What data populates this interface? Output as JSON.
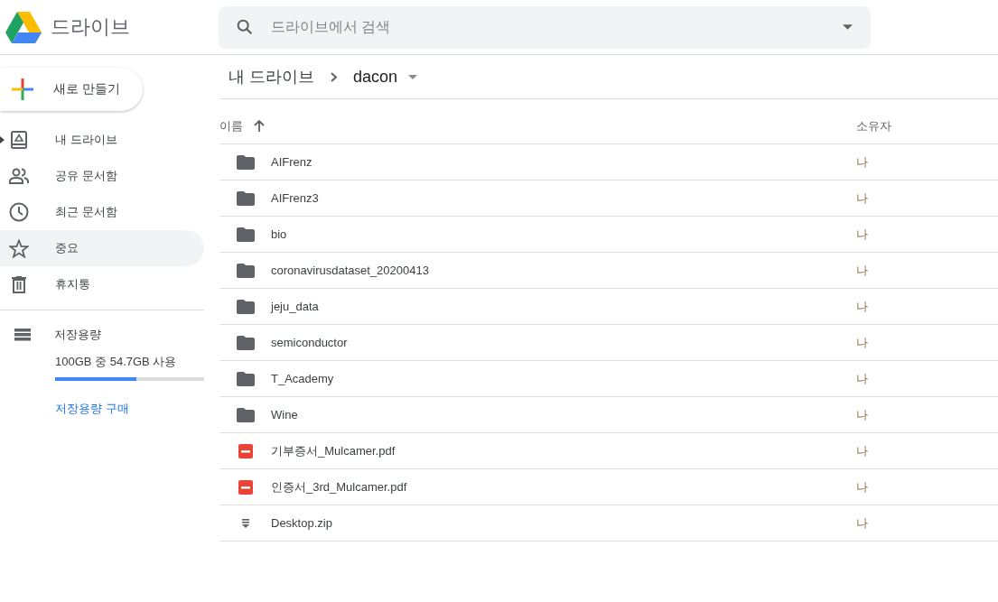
{
  "app": {
    "title": "드라이브"
  },
  "search": {
    "placeholder": "드라이브에서 검색"
  },
  "new_button": {
    "label": "새로 만들기"
  },
  "sidebar": {
    "items": [
      {
        "label": "내 드라이브",
        "kind": "drive",
        "selected": false,
        "expandable": true
      },
      {
        "label": "공유 문서함",
        "kind": "people",
        "selected": false,
        "expandable": false
      },
      {
        "label": "최근 문서함",
        "kind": "clock",
        "selected": false,
        "expandable": false
      },
      {
        "label": "중요",
        "kind": "star",
        "selected": true,
        "expandable": false
      },
      {
        "label": "휴지통",
        "kind": "trash",
        "selected": false,
        "expandable": false
      }
    ]
  },
  "storage": {
    "label": "저장용량",
    "usage": "100GB 중 54.7GB 사용",
    "level": 0.547,
    "buy_link": "저장용량 구매"
  },
  "breadcrumb": {
    "parent": "내 드라이브",
    "current": "dacon"
  },
  "table": {
    "columns": [
      "이름",
      "소유자"
    ],
    "rows": [
      {
        "name": "AIFrenz",
        "kind": "folder",
        "owner": "나"
      },
      {
        "name": "AIFrenz3",
        "kind": "folder",
        "owner": "나"
      },
      {
        "name": "bio",
        "kind": "folder",
        "owner": "나"
      },
      {
        "name": "coronavirusdataset_20200413",
        "kind": "folder",
        "owner": "나"
      },
      {
        "name": "jeju_data",
        "kind": "folder",
        "owner": "나"
      },
      {
        "name": "semiconductor",
        "kind": "folder",
        "owner": "나"
      },
      {
        "name": "T_Academy",
        "kind": "folder",
        "owner": "나"
      },
      {
        "name": "Wine",
        "kind": "folder",
        "owner": "나"
      },
      {
        "name": "기부증서_Mulcamer.pdf",
        "kind": "pdf",
        "owner": "나"
      },
      {
        "name": "인증서_3rd_Mulcamer.pdf",
        "kind": "pdf",
        "owner": "나"
      },
      {
        "name": "Desktop.zip",
        "kind": "zip",
        "owner": "나"
      }
    ]
  }
}
